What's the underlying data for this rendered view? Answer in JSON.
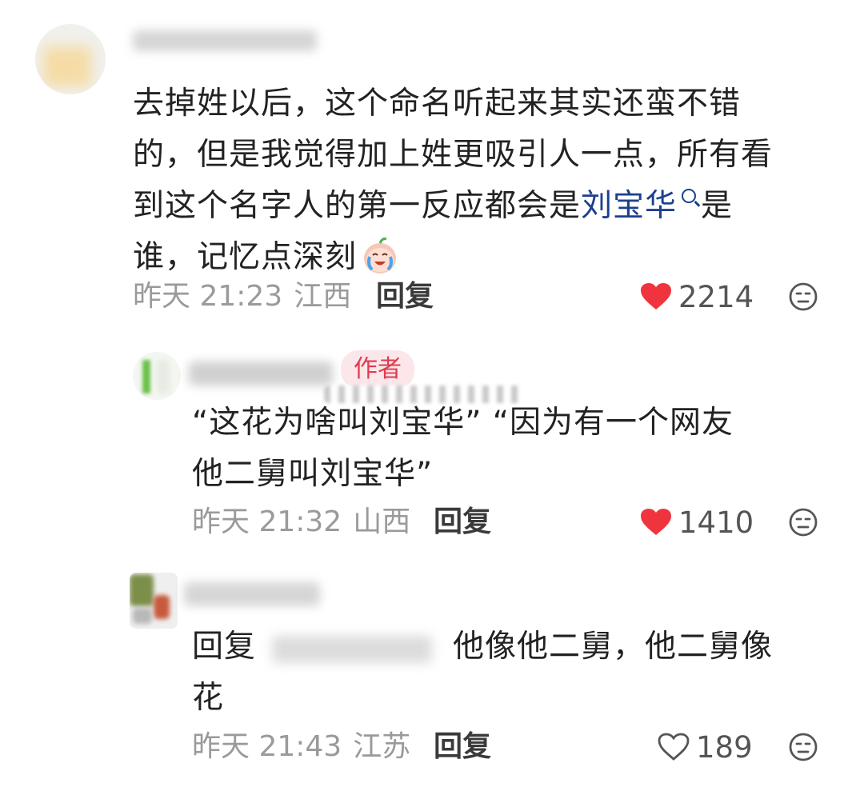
{
  "comments": [
    {
      "text_before_link": "去掉姓以后，这个命名听起来其实还蛮不错的，但是我觉得加上姓更吸引人一点，所有看到这个名字人的第一反应都会是",
      "line1": "去掉姓以后，这个命名听起来其实还蛮不错",
      "line2": "的，但是我觉得加上姓更吸引人一点，所有看",
      "line3_prefix": "到这个名字人的第一反应都会是",
      "link": "刘宝华",
      "line3_suffix": "是",
      "line4": "谁，记忆点深刻",
      "emoji": "cry-laugh-emoji",
      "time": "昨天 21:23",
      "location": "江西",
      "reply_label": "回复",
      "likes": "2214",
      "liked": true
    },
    {
      "badge": "作者",
      "line1": "“这花为啥叫刘宝华”  “因为有一个网友",
      "line2": "他二舅叫刘宝华”",
      "time": "昨天 21:32",
      "location": "山西",
      "reply_label": "回复",
      "likes": "1410",
      "liked": true
    },
    {
      "reply_prefix": "回复",
      "line1_after": "他像他二舅，他二舅像",
      "line2": "花",
      "time": "昨天 21:43",
      "location": "江苏",
      "reply_label": "回复",
      "likes": "189",
      "liked": false
    }
  ],
  "colors": {
    "heart_red": "#f0343e",
    "link_blue": "#1d3f8f",
    "meta_gray": "#9a9a9a",
    "badge_bg": "#fbe6e9",
    "badge_text": "#e23a50"
  }
}
